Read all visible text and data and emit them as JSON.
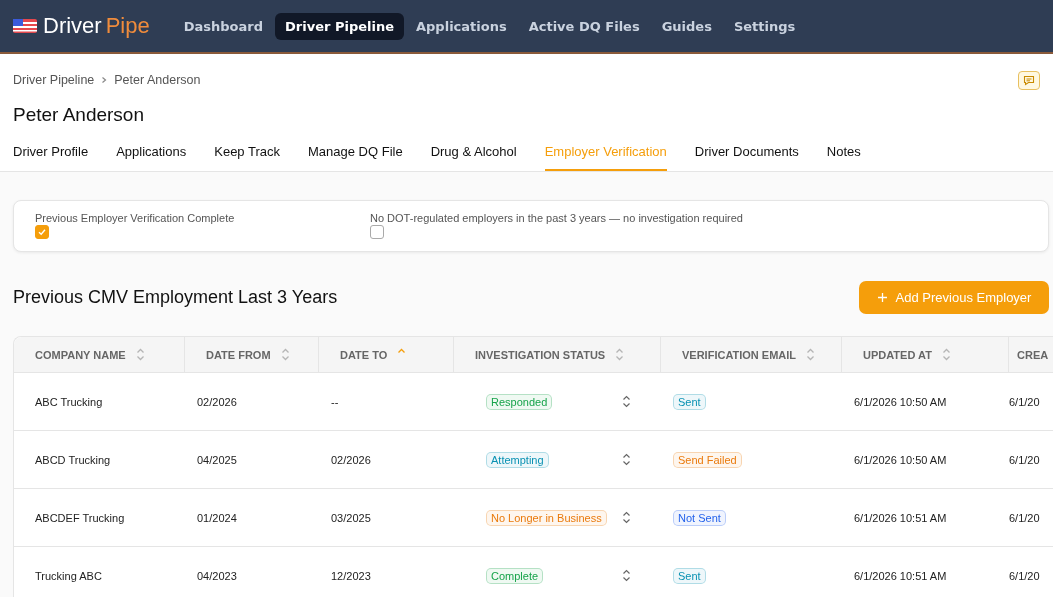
{
  "nav": {
    "brand_first": "Driver",
    "brand_second": "Pipe",
    "items": [
      {
        "label": "Dashboard",
        "selected": false
      },
      {
        "label": "Driver Pipeline",
        "selected": true
      },
      {
        "label": "Applications",
        "selected": false
      },
      {
        "label": "Active DQ Files",
        "selected": false
      },
      {
        "label": "Guides",
        "selected": false
      },
      {
        "label": "Settings",
        "selected": false
      }
    ]
  },
  "breadcrumb": [
    "Driver Pipeline",
    "Peter Anderson"
  ],
  "title": "Peter Anderson",
  "tabs": [
    {
      "label": "Driver Profile",
      "selected": false
    },
    {
      "label": "Applications",
      "selected": false
    },
    {
      "label": "Keep Track",
      "selected": false
    },
    {
      "label": "Manage DQ File",
      "selected": false
    },
    {
      "label": "Drug & Alcohol",
      "selected": false
    },
    {
      "label": "Employer Verification",
      "selected": true
    },
    {
      "label": "Driver Documents",
      "selected": false
    },
    {
      "label": "Notes",
      "selected": false
    }
  ],
  "checks": [
    {
      "label": "Previous Employer Verification Complete",
      "checked": true
    },
    {
      "label": "No DOT-regulated employers in the past 3 years — no investigation required",
      "checked": false
    }
  ],
  "section_title": "Previous CMV Employment Last 3 Years",
  "add_button": "Add Previous Employer",
  "table": {
    "columns": [
      {
        "label": "COMPANY NAME",
        "sorted": false
      },
      {
        "label": "DATE FROM",
        "sorted": false
      },
      {
        "label": "DATE TO",
        "sorted": true
      },
      {
        "label": "INVESTIGATION STATUS",
        "sorted": false
      },
      {
        "label": "VERIFICATION EMAIL",
        "sorted": false
      },
      {
        "label": "UPDATED AT",
        "sorted": false
      },
      {
        "label": "CREA"
      }
    ],
    "rows": [
      {
        "company": "ABC Trucking",
        "from": "02/2026",
        "to": "--",
        "status": {
          "label": "Responded",
          "color": "#16a34a"
        },
        "email": {
          "label": "Sent",
          "color": "#0891b2"
        },
        "updated": "6/1/2026 10:50 AM",
        "created": "6/1/20"
      },
      {
        "company": "ABCD Trucking",
        "from": "04/2025",
        "to": "02/2026",
        "status": {
          "label": "Attempting",
          "color": "#0891b2"
        },
        "email": {
          "label": "Send Failed",
          "color": "#ea7a0c"
        },
        "updated": "6/1/2026 10:50 AM",
        "created": "6/1/20"
      },
      {
        "company": "ABCDEF Trucking",
        "from": "01/2024",
        "to": "03/2025",
        "status": {
          "label": "No Longer in Business",
          "color": "#ea7a0c"
        },
        "email": {
          "label": "Not Sent",
          "color": "#2563eb"
        },
        "updated": "6/1/2026 10:51 AM",
        "created": "6/1/20"
      },
      {
        "company": "Trucking ABC",
        "from": "04/2023",
        "to": "12/2023",
        "status": {
          "label": "Complete",
          "color": "#16a34a"
        },
        "email": {
          "label": "Sent",
          "color": "#0891b2"
        },
        "updated": "6/1/2026 10:51 AM",
        "created": "6/1/20"
      }
    ]
  }
}
